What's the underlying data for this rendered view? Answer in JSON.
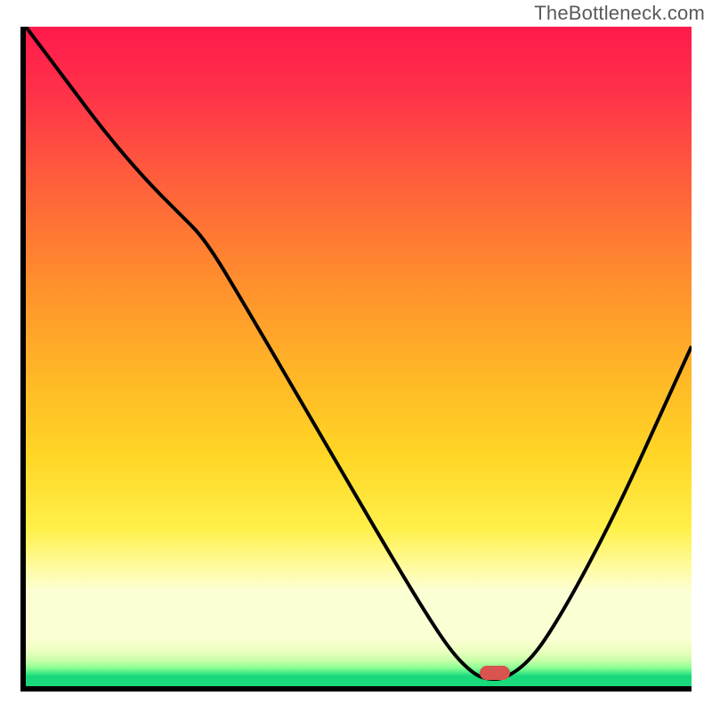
{
  "watermark": "TheBottleneck.com",
  "chart_data": {
    "type": "line",
    "title": "",
    "xlabel": "",
    "ylabel": "",
    "xlim": [
      0,
      100
    ],
    "ylim": [
      0,
      100
    ],
    "x": [
      0,
      6,
      12,
      18,
      23,
      27,
      33,
      40,
      47,
      54,
      60,
      64,
      67,
      69,
      72,
      76,
      80,
      85,
      90,
      95,
      100
    ],
    "values": [
      100,
      92,
      84,
      77,
      72,
      68,
      58,
      46,
      34,
      22,
      12,
      6,
      3,
      2,
      2,
      5,
      11,
      20,
      30,
      41,
      52
    ],
    "marker": {
      "x": 70.5,
      "y": 2
    },
    "annotations": [
      "TheBottleneck.com"
    ]
  }
}
